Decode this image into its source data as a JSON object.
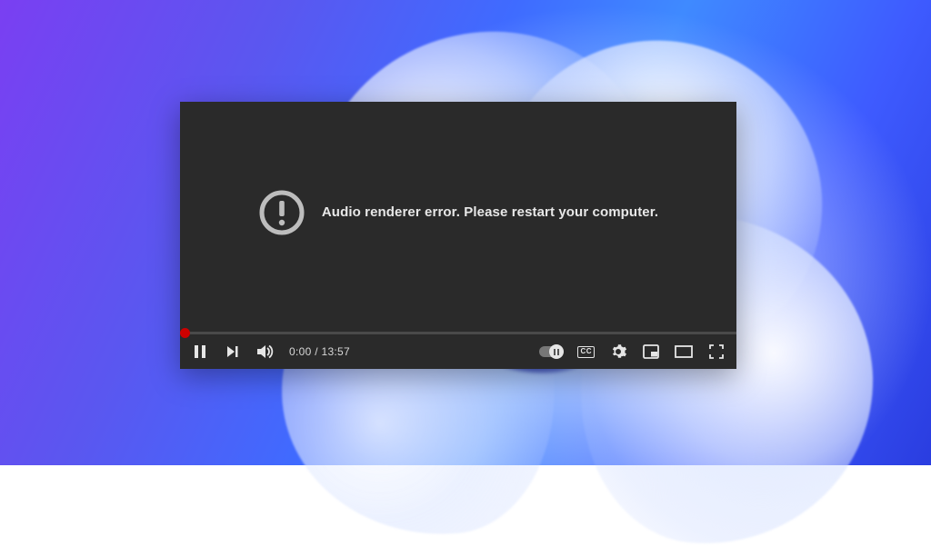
{
  "error": {
    "message": "Audio renderer error. Please restart your computer."
  },
  "player": {
    "current_time": "0:00",
    "separator": " / ",
    "duration": "13:57",
    "cc_label": "CC"
  }
}
